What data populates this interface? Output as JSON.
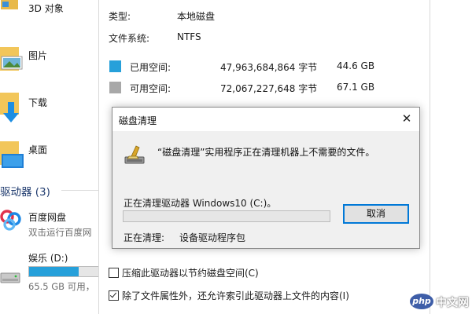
{
  "explorer": {
    "items": [
      {
        "label": "3D 对象",
        "icon": "folder-3d-icon"
      },
      {
        "label": "图片",
        "icon": "folder-pictures-icon"
      },
      {
        "label": "下载",
        "icon": "folder-downloads-icon"
      },
      {
        "label": "桌面",
        "icon": "folder-desktop-icon"
      }
    ],
    "section_title": "驱动器 (3)",
    "baidu": {
      "name": "百度网盘",
      "subtitle": "双击运行百度网",
      "icon": "baidu-netdisk-icon"
    },
    "drive": {
      "name": "娱乐 (D:)",
      "free_text": "65.5 GB 可用，",
      "usage_fraction": 0.72,
      "icon": "drive-icon"
    }
  },
  "properties": {
    "type_label": "类型:",
    "type_value": "本地磁盘",
    "fs_label": "文件系统:",
    "fs_value": "NTFS",
    "used": {
      "label": "已用空间:",
      "bytes": "47,963,684,864 字节",
      "gb": "44.6 GB",
      "color": "#26a0da"
    },
    "free": {
      "label": "可用空间:",
      "bytes": "72,067,227,648 字节",
      "gb": "67.1 GB",
      "color": "#a8a8a8"
    },
    "compress_label": "压缩此驱动器以节约磁盘空间(C)",
    "compress_checked": false,
    "index_label": "除了文件属性外，还允许索引此驱动器上文件的内容(I)",
    "index_checked": true
  },
  "dialog": {
    "title": "磁盘清理",
    "close_icon": "close-icon",
    "app_icon": "disk-cleanup-icon",
    "message": "“磁盘清理”实用程序正在清理机器上不需要的文件。",
    "progress_label": "正在清理驱动器 Windows10 (C:)。",
    "progress_fraction": 0.0,
    "cancel_label": "取消",
    "status_label": "正在清理:",
    "status_value": "设备驱动程序包"
  },
  "watermark": {
    "logo": "php",
    "text": "中文网"
  }
}
